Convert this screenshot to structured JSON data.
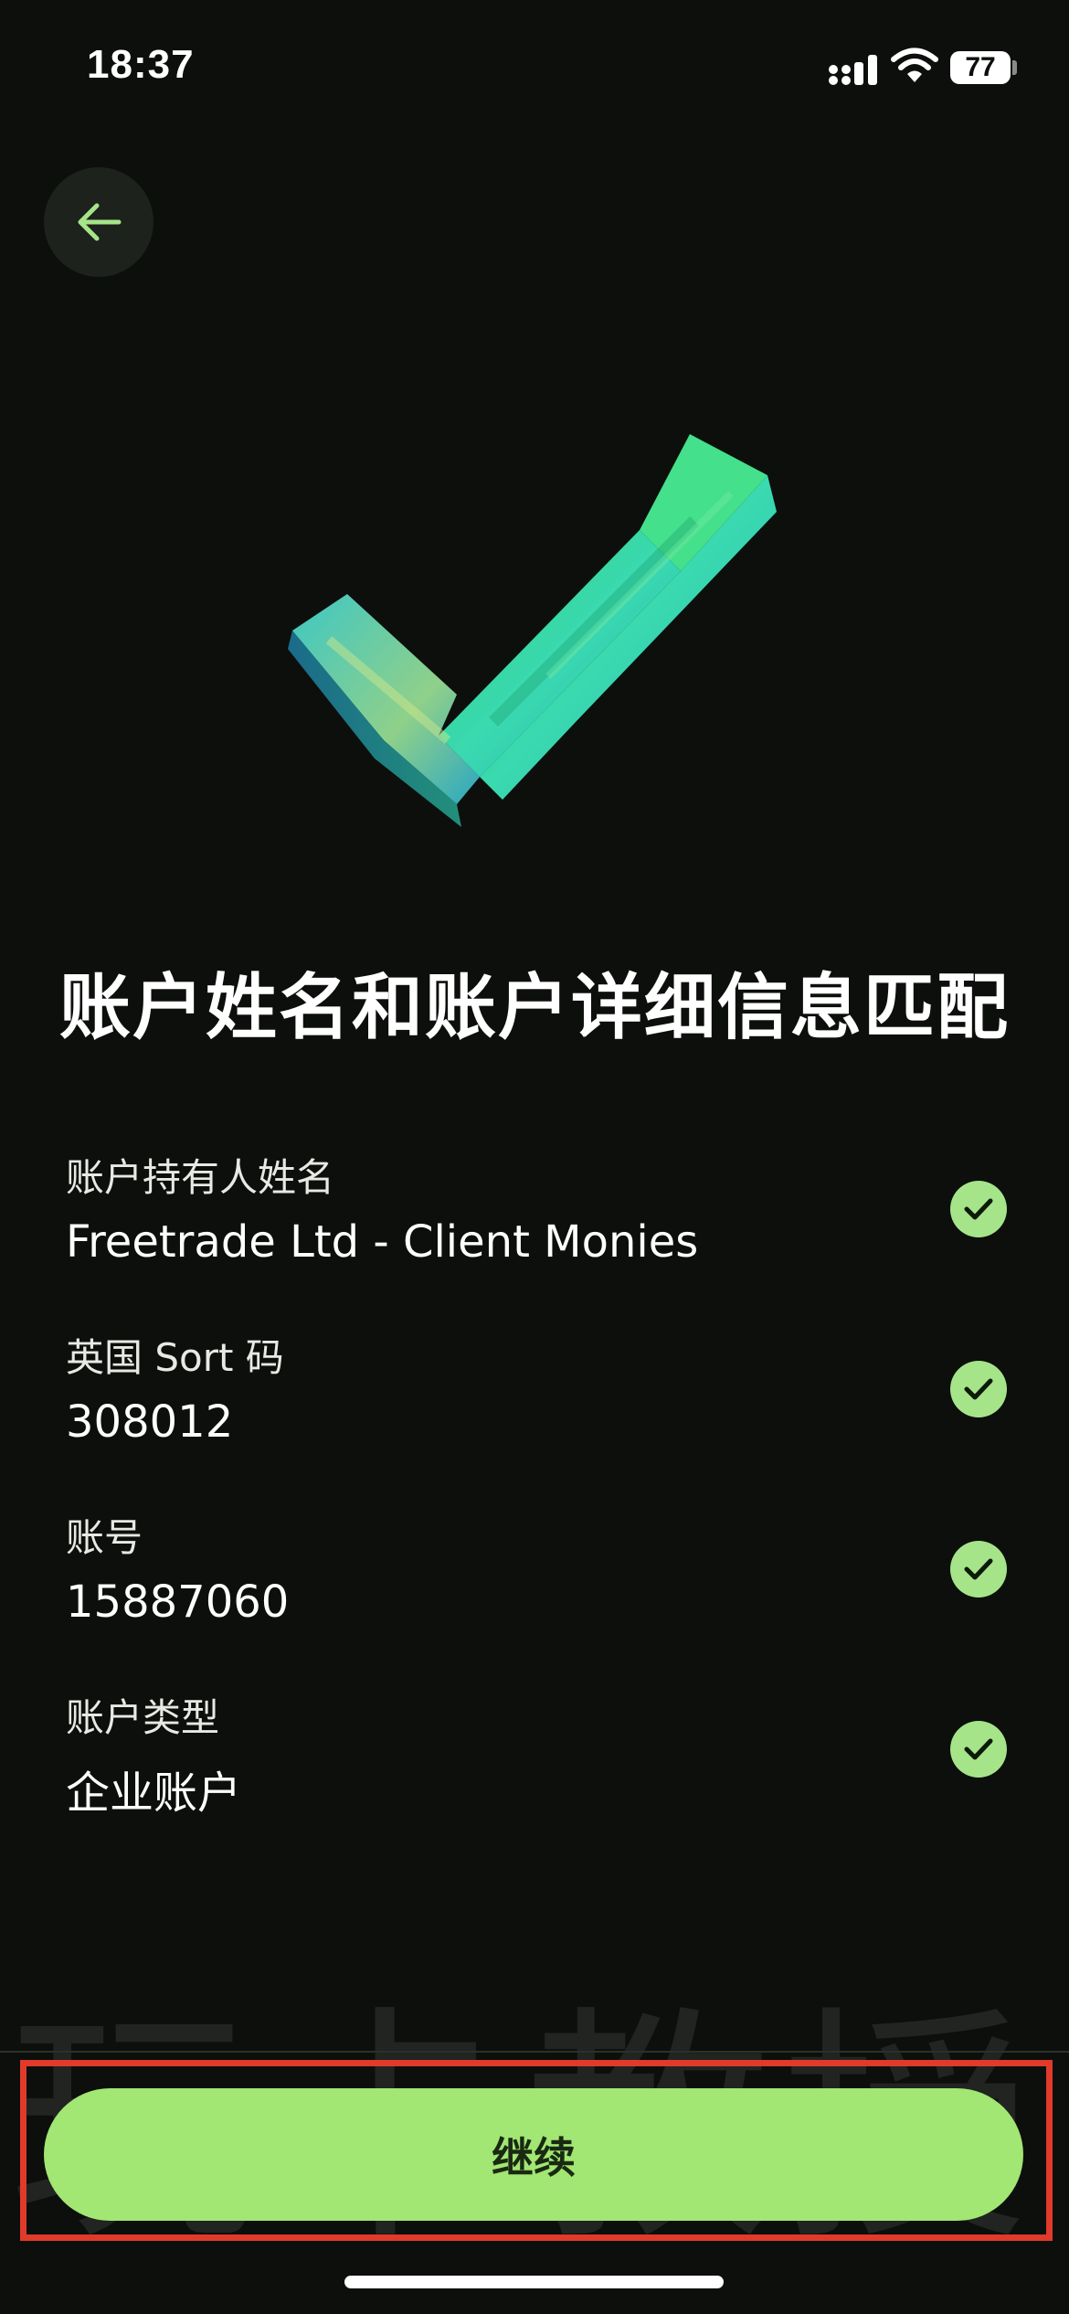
{
  "status_bar": {
    "time": "18:37",
    "battery": "77",
    "icons": [
      "signal-icon",
      "wifi-icon",
      "battery-icon"
    ]
  },
  "navigation": {
    "back_icon": "arrow-left-icon",
    "accent_color": "#a6e48a"
  },
  "hero": {
    "icon": "checkmark-3d-icon"
  },
  "title": "账户姓名和账户详细信息匹配",
  "details": [
    {
      "label": "账户持有人姓名",
      "value": "Freetrade Ltd - Client Monies",
      "status_icon": "check-circle-icon"
    },
    {
      "label": "英国 Sort 码",
      "value": "308012",
      "status_icon": "check-circle-icon"
    },
    {
      "label": "账号",
      "value": "15887060",
      "status_icon": "check-circle-icon"
    },
    {
      "label": "账户类型",
      "value": "企业账户",
      "status_icon": "check-circle-icon"
    }
  ],
  "watermark": "玩卡教授",
  "continue_button": {
    "label": "继续",
    "color": "#a2e673"
  },
  "highlight_color": "#e03a2b"
}
